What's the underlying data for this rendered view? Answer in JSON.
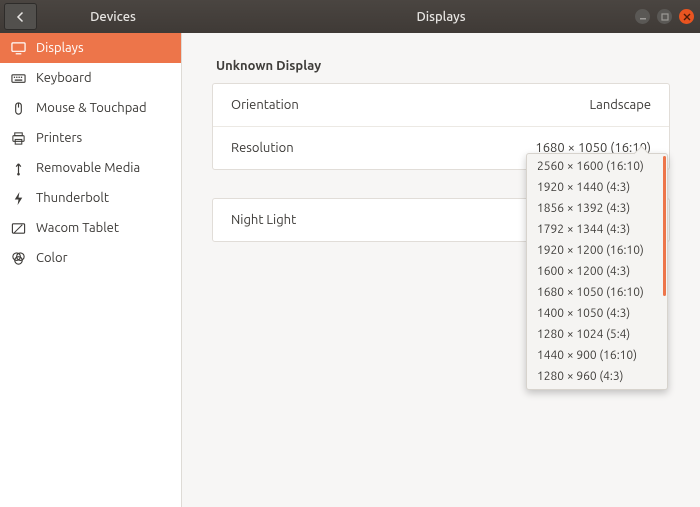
{
  "titlebar": {
    "back_label": "Back",
    "left_title": "Devices",
    "center_title": "Displays"
  },
  "sidebar": {
    "items": [
      {
        "id": "displays",
        "label": "Displays",
        "icon": "displays-icon",
        "active": true
      },
      {
        "id": "keyboard",
        "label": "Keyboard",
        "icon": "keyboard-icon",
        "active": false
      },
      {
        "id": "mouse",
        "label": "Mouse & Touchpad",
        "icon": "mouse-icon",
        "active": false
      },
      {
        "id": "printers",
        "label": "Printers",
        "icon": "printer-icon",
        "active": false
      },
      {
        "id": "removable",
        "label": "Removable Media",
        "icon": "usb-icon",
        "active": false
      },
      {
        "id": "thunderbolt",
        "label": "Thunderbolt",
        "icon": "thunderbolt-icon",
        "active": false
      },
      {
        "id": "wacom",
        "label": "Wacom Tablet",
        "icon": "tablet-icon",
        "active": false
      },
      {
        "id": "color",
        "label": "Color",
        "icon": "color-icon",
        "active": false
      }
    ]
  },
  "content": {
    "section_title": "Unknown Display",
    "rows": {
      "orientation": {
        "label": "Orientation",
        "value": "Landscape"
      },
      "resolution": {
        "label": "Resolution",
        "value": "1680 × 1050 (16:10)"
      }
    },
    "night_light": {
      "label": "Night Light",
      "value": ""
    }
  },
  "resolution_menu": {
    "options": [
      "2560 × 1600 (16:10)",
      "1920 × 1440 (4:3)",
      "1856 × 1392 (4:3)",
      "1792 × 1344 (4:3)",
      "1920 × 1200 (16:10)",
      "1600 × 1200 (4:3)",
      "1680 × 1050 (16:10)",
      "1400 × 1050 (4:3)",
      "1280 × 1024 (5:4)",
      "1440 × 900 (16:10)",
      "1280 × 960 (4:3)"
    ]
  },
  "colors": {
    "accent": "#ed754a"
  }
}
